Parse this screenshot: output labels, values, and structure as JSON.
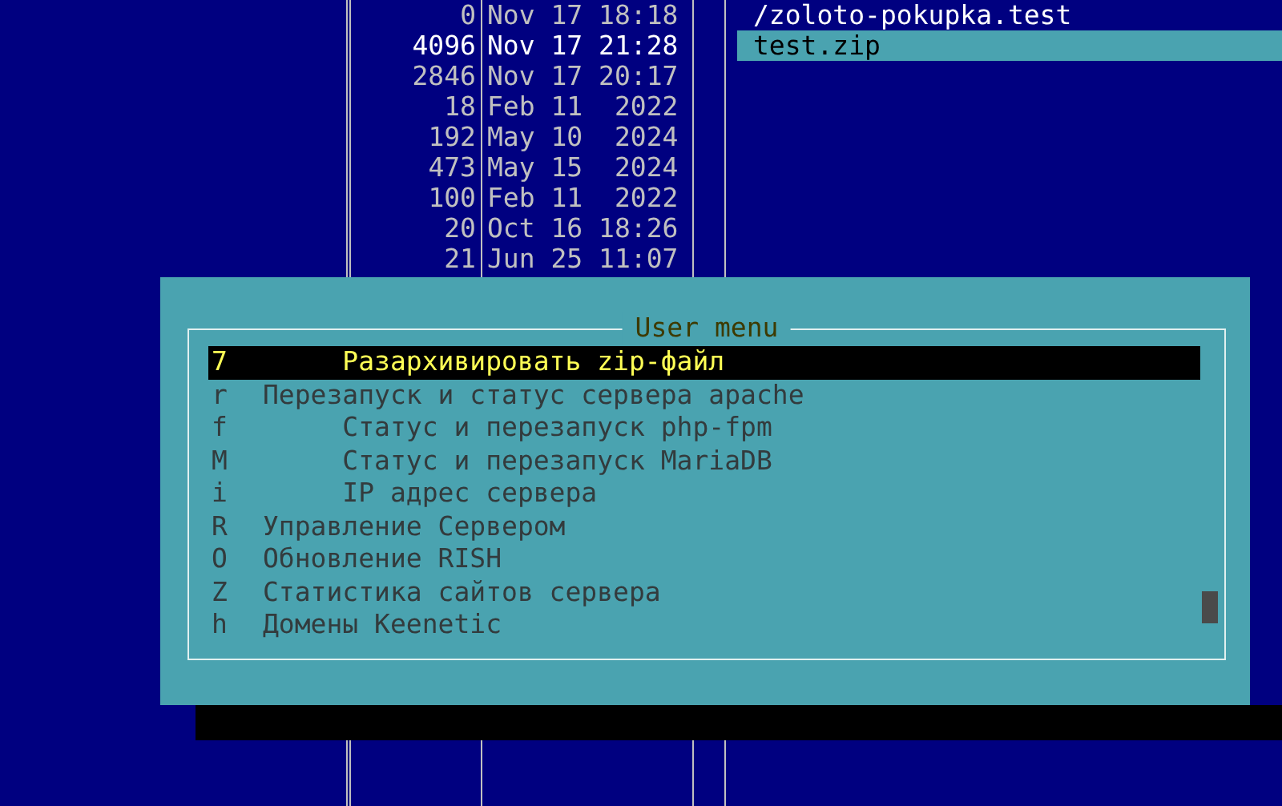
{
  "left_panel": {
    "rows": [
      {
        "size": "0",
        "modified": "Nov 17 18:18"
      },
      {
        "size": "4096",
        "modified": "Nov 17 21:28"
      },
      {
        "size": "2846",
        "modified": "Nov 17 20:17"
      },
      {
        "size": "18",
        "modified": "Feb 11  2022"
      },
      {
        "size": "192",
        "modified": "May 10  2024"
      },
      {
        "size": "473",
        "modified": "May 15  2024"
      },
      {
        "size": "100",
        "modified": "Feb 11  2022"
      },
      {
        "size": "20",
        "modified": "Oct 16 18:26"
      },
      {
        "size": "21",
        "modified": "Jun 25 11:07"
      }
    ]
  },
  "right_panel": {
    "rows": [
      {
        "name": "/zoloto-pokupka.test",
        "selected": false
      },
      {
        "name": "test.zip",
        "selected": true
      }
    ]
  },
  "user_menu": {
    "title": "User menu",
    "items": [
      {
        "key": "7",
        "label": "     Разархивировать zip-файл",
        "selected": true
      },
      {
        "key": "r",
        "label": "Перезапуск и статус сервера apache",
        "selected": false
      },
      {
        "key": "f",
        "label": "     Статус и перезапуск php-fpm",
        "selected": false
      },
      {
        "key": "M",
        "label": "     Статус и перезапуск MariaDB",
        "selected": false
      },
      {
        "key": "i",
        "label": "     IP адрес сервера",
        "selected": false
      },
      {
        "key": "R",
        "label": "Управление Сервером",
        "selected": false
      },
      {
        "key": "O",
        "label": "Обновление RISH",
        "selected": false
      },
      {
        "key": "Z",
        "label": "Статистика сайтов сервера",
        "selected": false
      },
      {
        "key": "h",
        "label": "Домены Keenetic",
        "selected": false
      }
    ]
  }
}
